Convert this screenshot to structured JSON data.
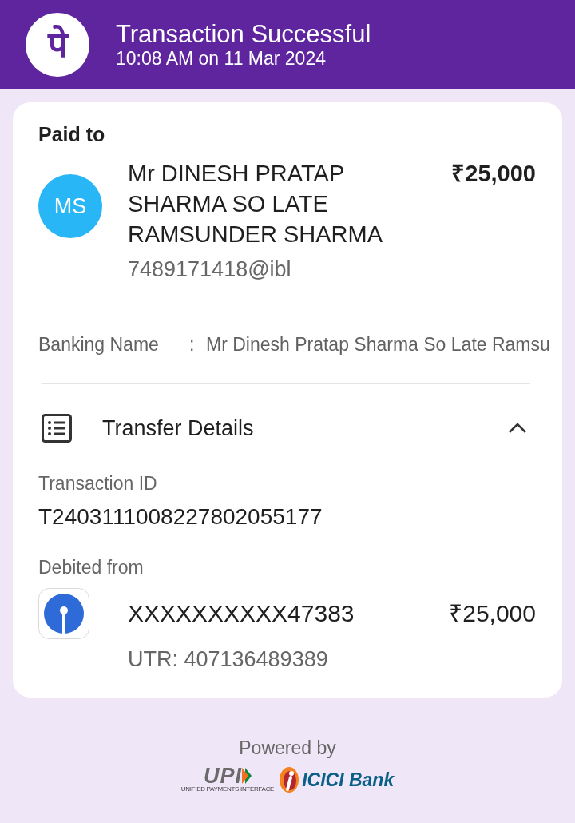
{
  "header": {
    "logo_text": "पे",
    "title": "Transaction Successful",
    "timestamp": "10:08 AM on 11 Mar 2024"
  },
  "paid_to": {
    "label": "Paid to",
    "avatar_initials": "MS",
    "name": "Mr DINESH PRATAP SHARMA SO LATE RAMSUNDER SHARMA",
    "upi_id": "7489171418@ibl",
    "amount": "₹25,000"
  },
  "banking_name": {
    "label": "Banking Name",
    "separator": ":",
    "value": "Mr Dinesh Pratap Sharma So Late Ramsu"
  },
  "transfer_details": {
    "title": "Transfer Details",
    "expanded": true,
    "fields": [
      {
        "label": "Transaction ID",
        "value": "T2403111008227802055177"
      }
    ],
    "debited_from": {
      "label": "Debited from",
      "account": "XXXXXXXXXX47383",
      "amount": "₹25,000",
      "utr": "UTR: 407136489389"
    }
  },
  "footer": {
    "powered_by": "Powered by",
    "upi_logo": {
      "text": "UPI",
      "caption": "UNIFIED PAYMENTS INTERFACE"
    },
    "bank_logo": {
      "text": "ICICI Bank"
    }
  }
}
